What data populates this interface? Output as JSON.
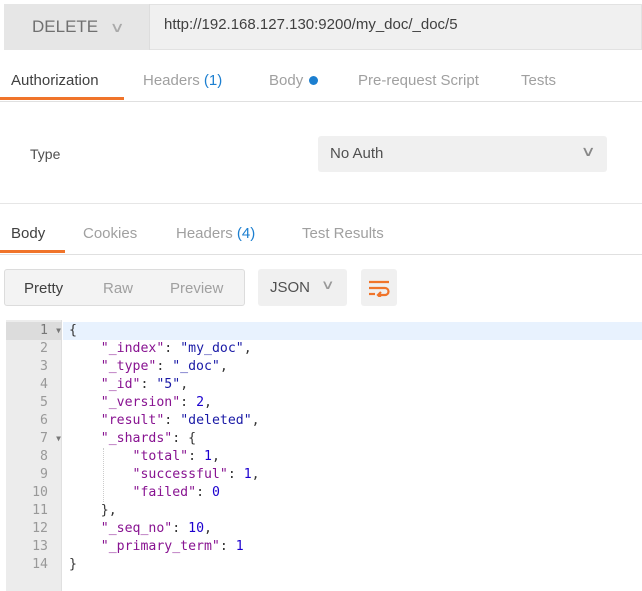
{
  "request": {
    "method": "DELETE",
    "url": "http://192.168.127.130:9200/my_doc/_doc/5"
  },
  "request_tabs": [
    {
      "label": "Authorization",
      "count": "",
      "active": true
    },
    {
      "label": "Headers",
      "count": "(1)"
    },
    {
      "label": "Body",
      "dot": true
    },
    {
      "label": "Pre-request Script"
    },
    {
      "label": "Tests"
    }
  ],
  "auth": {
    "type_label": "Type",
    "type_value": "No Auth"
  },
  "response_tabs": [
    {
      "label": "Body",
      "active": true
    },
    {
      "label": "Cookies"
    },
    {
      "label": "Headers",
      "count": "(4)"
    },
    {
      "label": "Test Results"
    }
  ],
  "view": {
    "modes": [
      "Pretty",
      "Raw",
      "Preview"
    ],
    "active": "Pretty",
    "format": "JSON",
    "wrap_icon": "wrap-lines-icon"
  },
  "colors": {
    "accent": "#f0742a",
    "count": "#1c7fd0",
    "key": "#881391",
    "string": "#1a1aa6",
    "number": "#1c00cf"
  },
  "code_lines": [
    [
      {
        "t": "{",
        "c": "p"
      }
    ],
    [
      {
        "t": "    ",
        "c": "p"
      },
      {
        "t": "\"_index\"",
        "c": "k"
      },
      {
        "t": ": ",
        "c": "p"
      },
      {
        "t": "\"my_doc\"",
        "c": "s"
      },
      {
        "t": ",",
        "c": "p"
      }
    ],
    [
      {
        "t": "    ",
        "c": "p"
      },
      {
        "t": "\"_type\"",
        "c": "k"
      },
      {
        "t": ": ",
        "c": "p"
      },
      {
        "t": "\"_doc\"",
        "c": "s"
      },
      {
        "t": ",",
        "c": "p"
      }
    ],
    [
      {
        "t": "    ",
        "c": "p"
      },
      {
        "t": "\"_id\"",
        "c": "k"
      },
      {
        "t": ": ",
        "c": "p"
      },
      {
        "t": "\"5\"",
        "c": "s"
      },
      {
        "t": ",",
        "c": "p"
      }
    ],
    [
      {
        "t": "    ",
        "c": "p"
      },
      {
        "t": "\"_version\"",
        "c": "k"
      },
      {
        "t": ": ",
        "c": "p"
      },
      {
        "t": "2",
        "c": "n"
      },
      {
        "t": ",",
        "c": "p"
      }
    ],
    [
      {
        "t": "    ",
        "c": "p"
      },
      {
        "t": "\"result\"",
        "c": "k"
      },
      {
        "t": ": ",
        "c": "p"
      },
      {
        "t": "\"deleted\"",
        "c": "s"
      },
      {
        "t": ",",
        "c": "p"
      }
    ],
    [
      {
        "t": "    ",
        "c": "p"
      },
      {
        "t": "\"_shards\"",
        "c": "k"
      },
      {
        "t": ": {",
        "c": "p"
      }
    ],
    [
      {
        "t": "        ",
        "c": "p"
      },
      {
        "t": "\"total\"",
        "c": "k"
      },
      {
        "t": ": ",
        "c": "p"
      },
      {
        "t": "1",
        "c": "n"
      },
      {
        "t": ",",
        "c": "p"
      }
    ],
    [
      {
        "t": "        ",
        "c": "p"
      },
      {
        "t": "\"successful\"",
        "c": "k"
      },
      {
        "t": ": ",
        "c": "p"
      },
      {
        "t": "1",
        "c": "n"
      },
      {
        "t": ",",
        "c": "p"
      }
    ],
    [
      {
        "t": "        ",
        "c": "p"
      },
      {
        "t": "\"failed\"",
        "c": "k"
      },
      {
        "t": ": ",
        "c": "p"
      },
      {
        "t": "0",
        "c": "n"
      }
    ],
    [
      {
        "t": "    },",
        "c": "p"
      }
    ],
    [
      {
        "t": "    ",
        "c": "p"
      },
      {
        "t": "\"_seq_no\"",
        "c": "k"
      },
      {
        "t": ": ",
        "c": "p"
      },
      {
        "t": "10",
        "c": "n"
      },
      {
        "t": ",",
        "c": "p"
      }
    ],
    [
      {
        "t": "    ",
        "c": "p"
      },
      {
        "t": "\"_primary_term\"",
        "c": "k"
      },
      {
        "t": ": ",
        "c": "p"
      },
      {
        "t": "1",
        "c": "n"
      }
    ],
    [
      {
        "t": "}",
        "c": "p"
      }
    ]
  ],
  "foldable_lines": [
    1,
    7
  ],
  "current_line": 1
}
